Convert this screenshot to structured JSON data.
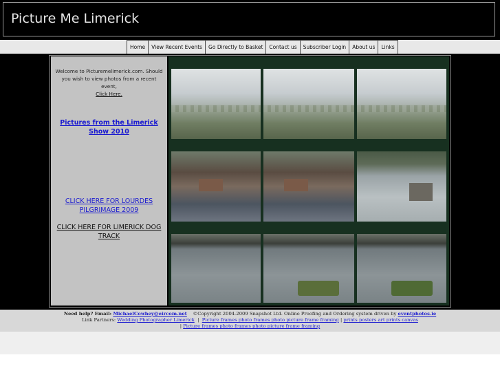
{
  "header": {
    "title": "Picture Me Limerick"
  },
  "nav": {
    "items": [
      {
        "label": "Home"
      },
      {
        "label": "View Recent Events"
      },
      {
        "label": "Go Directly to Basket"
      },
      {
        "label": "Contact us"
      },
      {
        "label": "Subscriber Login"
      },
      {
        "label": "About us"
      },
      {
        "label": "Links"
      }
    ]
  },
  "sidebar": {
    "welcome_text": "Welcome to Picturemelimerick.com. Should you wish to view photos from a recent event,",
    "click_here": "Click Here.",
    "link_show": "Pictures from the Limerick Show 2010",
    "link_lourdes": "CLICK HERE FOR LOURDES PILGRIMAGE 2009",
    "link_dog": "CLICK HERE FOR LIMERICK DOG TRACK"
  },
  "footer": {
    "help_label": "Need help? Email:",
    "help_email": "MichaelCowhey@eircom.net",
    "copyright": "©Copyright 2004-2009 Snapshot Ltd. Online Proofing and Ordering system driven by",
    "driver_link": "eventphotos.ie",
    "partners_label": "Link Partners:",
    "partner_links": [
      "Wedding Photographer Limerick",
      "Picture frames photo frames photo picture frame framing",
      "prints posters art prints canvas",
      "Picture frames photo frames photo picture frame framing"
    ],
    "separator": "|"
  },
  "colors": {
    "header_bg": "#000000",
    "header_text": "#e6e6e6",
    "sidebar_bg": "#c3c3c3",
    "link_blue": "#1a1ad0",
    "footer_bg": "#d8d8d8",
    "footer_link": "#1a1ad0",
    "photo_bg": "#173020"
  }
}
